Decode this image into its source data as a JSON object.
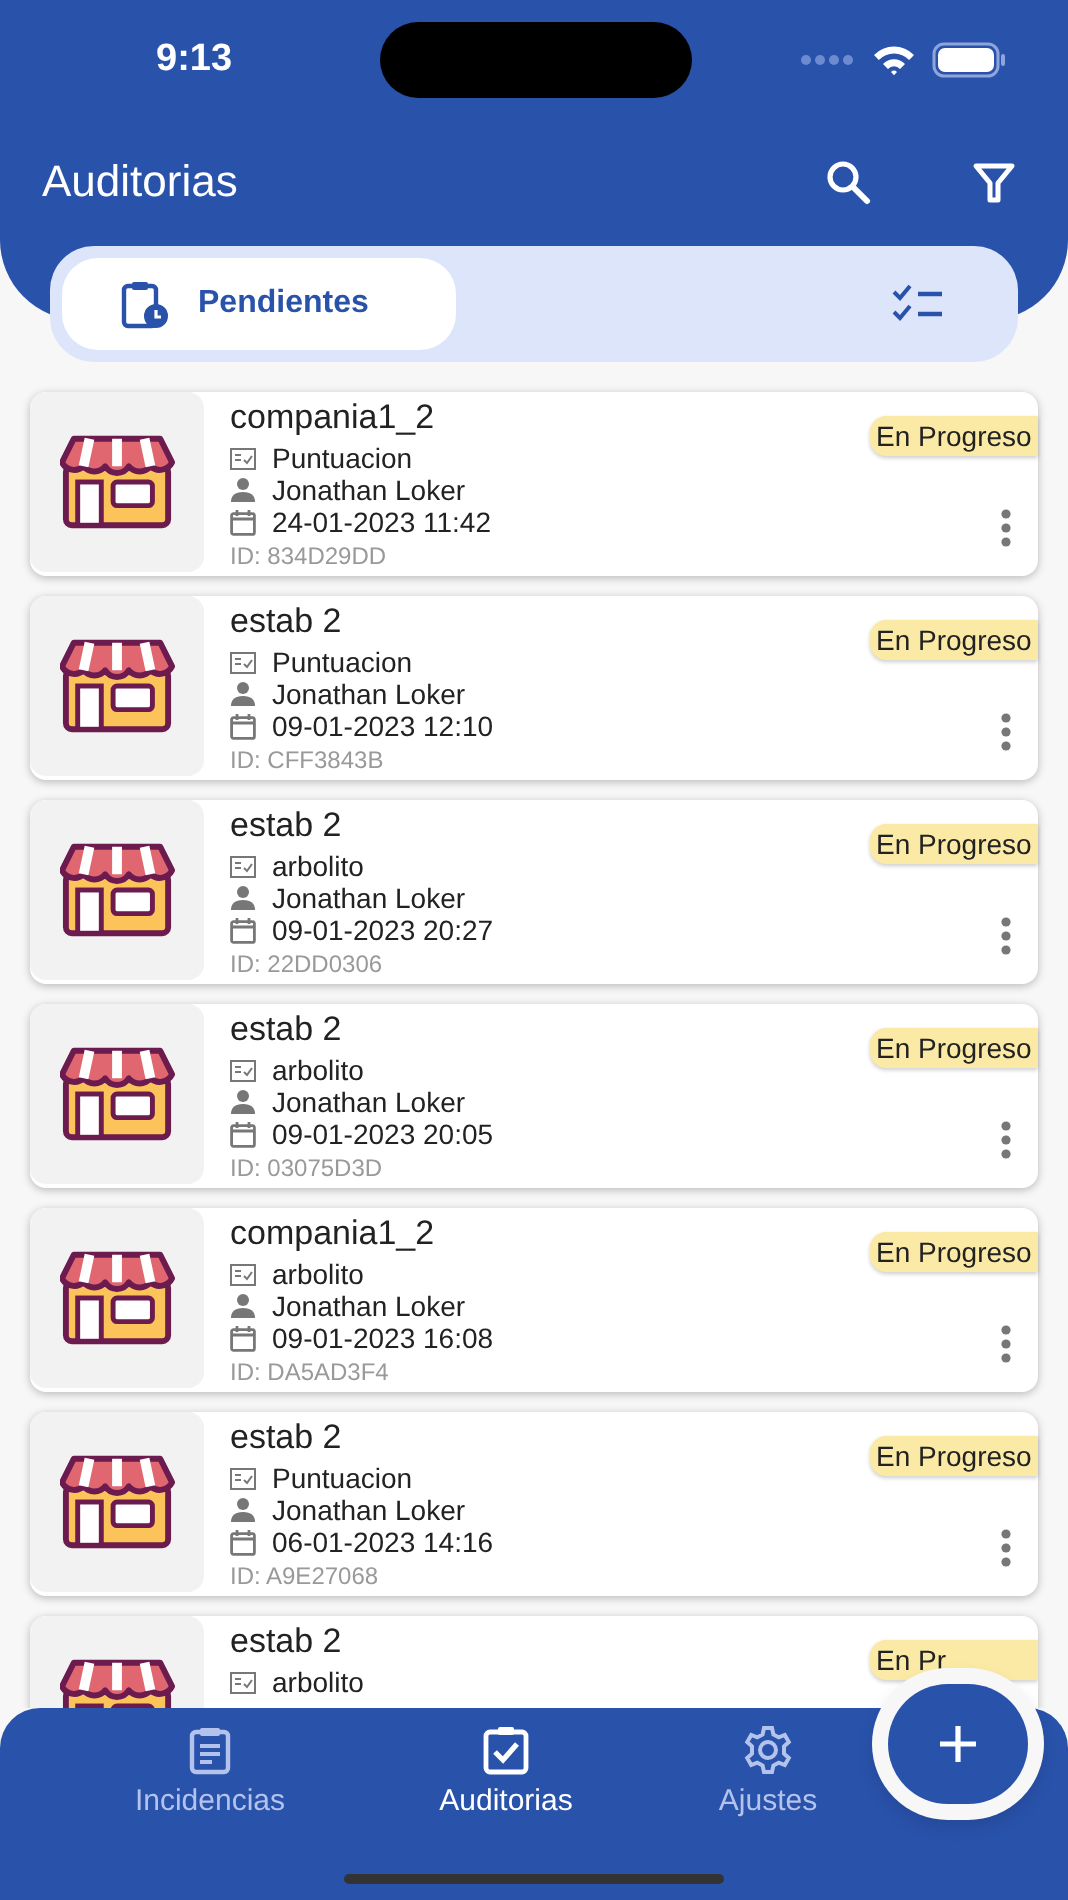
{
  "status_bar": {
    "time": "9:13"
  },
  "header": {
    "title": "Auditorias"
  },
  "tabs": [
    {
      "label": "Pendientes",
      "selected": true
    },
    {
      "selected": false
    }
  ],
  "audits": [
    {
      "name": "compania1_2",
      "type": "Puntuacion",
      "user": "Jonathan Loker",
      "date": "24-01-2023 11:42",
      "id": "ID: 834D29DD",
      "status": "En Progreso"
    },
    {
      "name": "estab 2",
      "type": "Puntuacion",
      "user": "Jonathan Loker",
      "date": "09-01-2023 12:10",
      "id": "ID: CFF3843B",
      "status": "En Progreso"
    },
    {
      "name": "estab 2",
      "type": "arbolito",
      "user": "Jonathan Loker",
      "date": "09-01-2023 20:27",
      "id": "ID: 22DD0306",
      "status": "En Progreso"
    },
    {
      "name": "estab 2",
      "type": "arbolito",
      "user": "Jonathan Loker",
      "date": "09-01-2023 20:05",
      "id": "ID: 03075D3D",
      "status": "En Progreso"
    },
    {
      "name": "compania1_2",
      "type": "arbolito",
      "user": "Jonathan Loker",
      "date": "09-01-2023 16:08",
      "id": "ID: DA5AD3F4",
      "status": "En Progreso"
    },
    {
      "name": "estab 2",
      "type": "Puntuacion",
      "user": "Jonathan Loker",
      "date": "06-01-2023 14:16",
      "id": "ID: A9E27068",
      "status": "En Progreso"
    },
    {
      "name": "estab 2",
      "type": "arbolito",
      "status": "En Pr"
    }
  ],
  "bottom_nav": [
    {
      "label": "Incidencias",
      "selected": false
    },
    {
      "label": "Auditorias",
      "selected": true
    },
    {
      "label": "Ajustes",
      "selected": false
    }
  ]
}
